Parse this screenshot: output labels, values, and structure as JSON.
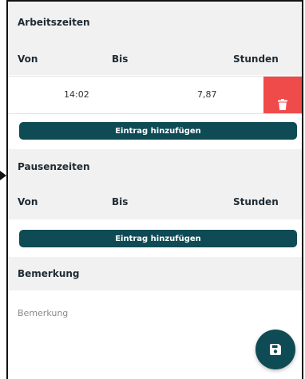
{
  "work": {
    "title": "Arbeitszeiten",
    "columns": {
      "from": "Von",
      "to": "Bis",
      "hours": "Stunden"
    },
    "rows": [
      {
        "from": "",
        "to": "14:02",
        "hours": "7,87"
      }
    ],
    "add_label": "Eintrag hinzufügen"
  },
  "breaks": {
    "title": "Pausenzeiten",
    "columns": {
      "from": "Von",
      "to": "Bis",
      "hours": "Stunden"
    },
    "add_label": "Eintrag hinzufügen"
  },
  "remark": {
    "title": "Bemerkung",
    "placeholder": "Bemerkung",
    "value": ""
  },
  "icons": {
    "delete": "trash-icon",
    "save": "save-icon"
  },
  "colors": {
    "primary": "#0f4b55",
    "danger": "#ef4b4b",
    "header_bg": "#f1f1f1"
  }
}
